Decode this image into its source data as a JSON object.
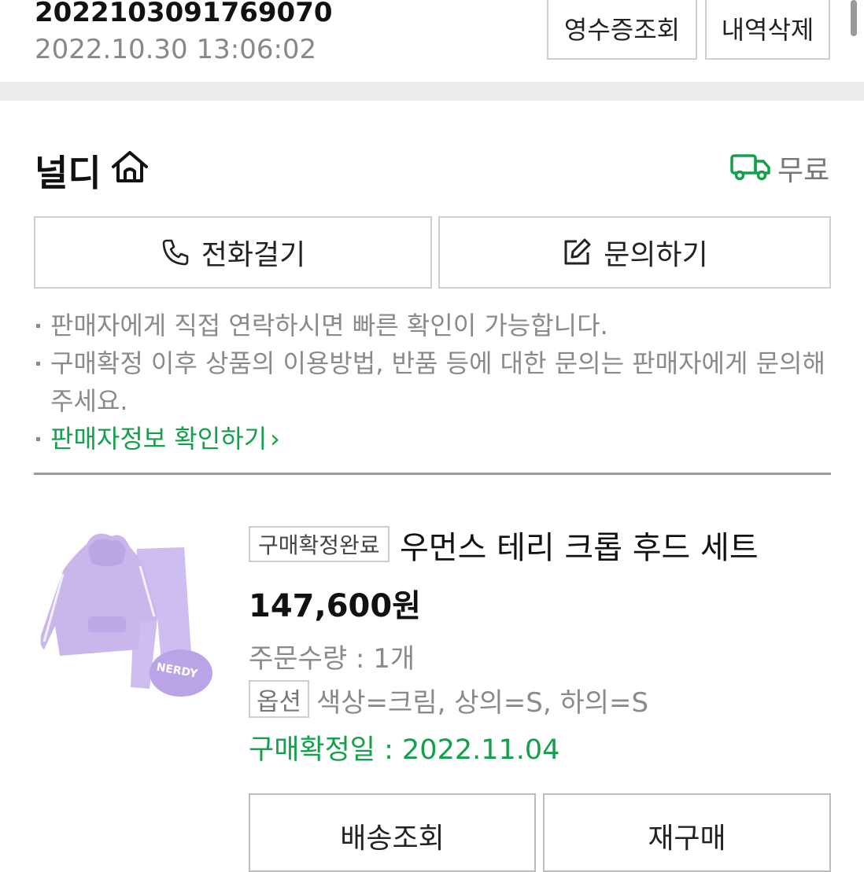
{
  "order": {
    "number": "2022103091769070",
    "datetime": "2022.10.30 13:06:02",
    "receipt_label": "영수증조회",
    "delete_label": "내역삭제"
  },
  "seller": {
    "name": "널디",
    "shipping_fee": "무료",
    "call_label": "전화걸기",
    "inquiry_label": "문의하기",
    "notes": [
      "판매자에게 직접 연락하시면 빠른 확인이 가능합니다.",
      "구매확정 이후 상품의 이용방법, 반품 등에 대한 문의는 판매자에게 문의해 주세요."
    ],
    "info_link": "판매자정보 확인하기",
    "info_link_chevron": "›"
  },
  "product": {
    "status": "구매확정완료",
    "title": "우먼스 테리 크롭 후드 세트",
    "price": "147,600원",
    "quantity": "주문수량 : 1개",
    "option_label": "옵션",
    "option_value": "색상=크림, 상의=S, 하의=S",
    "confirm_date": "구매확정일 : 2022.11.04",
    "thumbnail_print": "NERDY",
    "track_label": "배송조회",
    "rebuy_label": "재구매"
  },
  "colors": {
    "accent_green": "#12a04a",
    "thumbnail_lavender": "#c9b7ec",
    "border_gray": "#cfcfcf"
  },
  "icons": [
    "home-icon",
    "truck-icon",
    "phone-icon",
    "edit-icon",
    "chevron-right-icon"
  ]
}
